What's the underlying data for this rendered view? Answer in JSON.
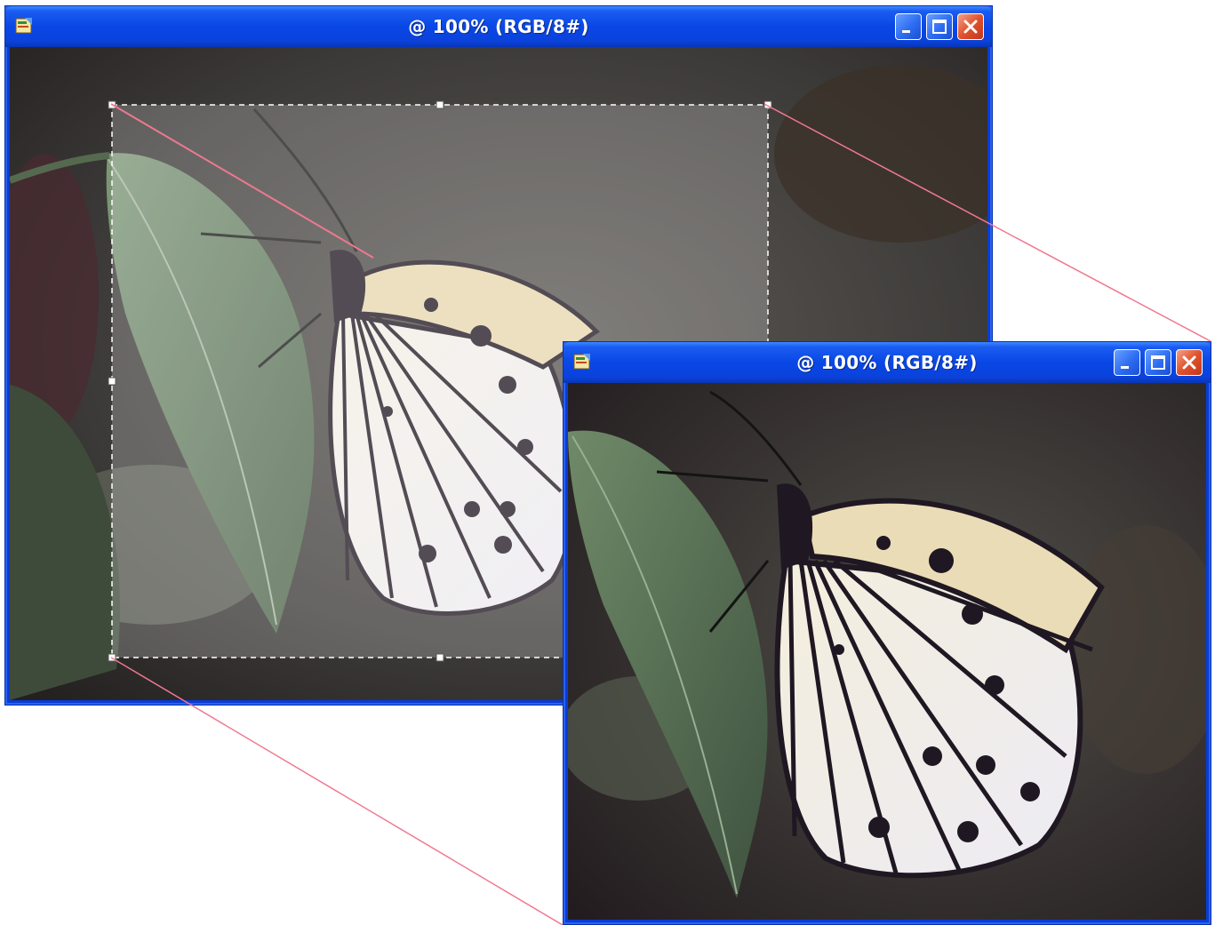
{
  "windows": [
    {
      "title": "@ 100% (RGB/8#)",
      "buttons": [
        "minimize",
        "maximize",
        "close"
      ],
      "role": "source document with crop selection"
    },
    {
      "title": "@ 100% (RGB/8#)",
      "buttons": [
        "minimize",
        "maximize",
        "close"
      ],
      "role": "cropped result document"
    }
  ],
  "icons": {
    "app": "photoshop-document-icon",
    "minimize": "minimize-icon",
    "maximize": "maximize-icon",
    "close": "close-icon"
  },
  "colors": {
    "titlebar": "#0a47e6",
    "frame": "#0a3cd4",
    "close_button": "#e0522c",
    "leader_line": "#f07890",
    "selection_overlay": "#ffffff"
  }
}
